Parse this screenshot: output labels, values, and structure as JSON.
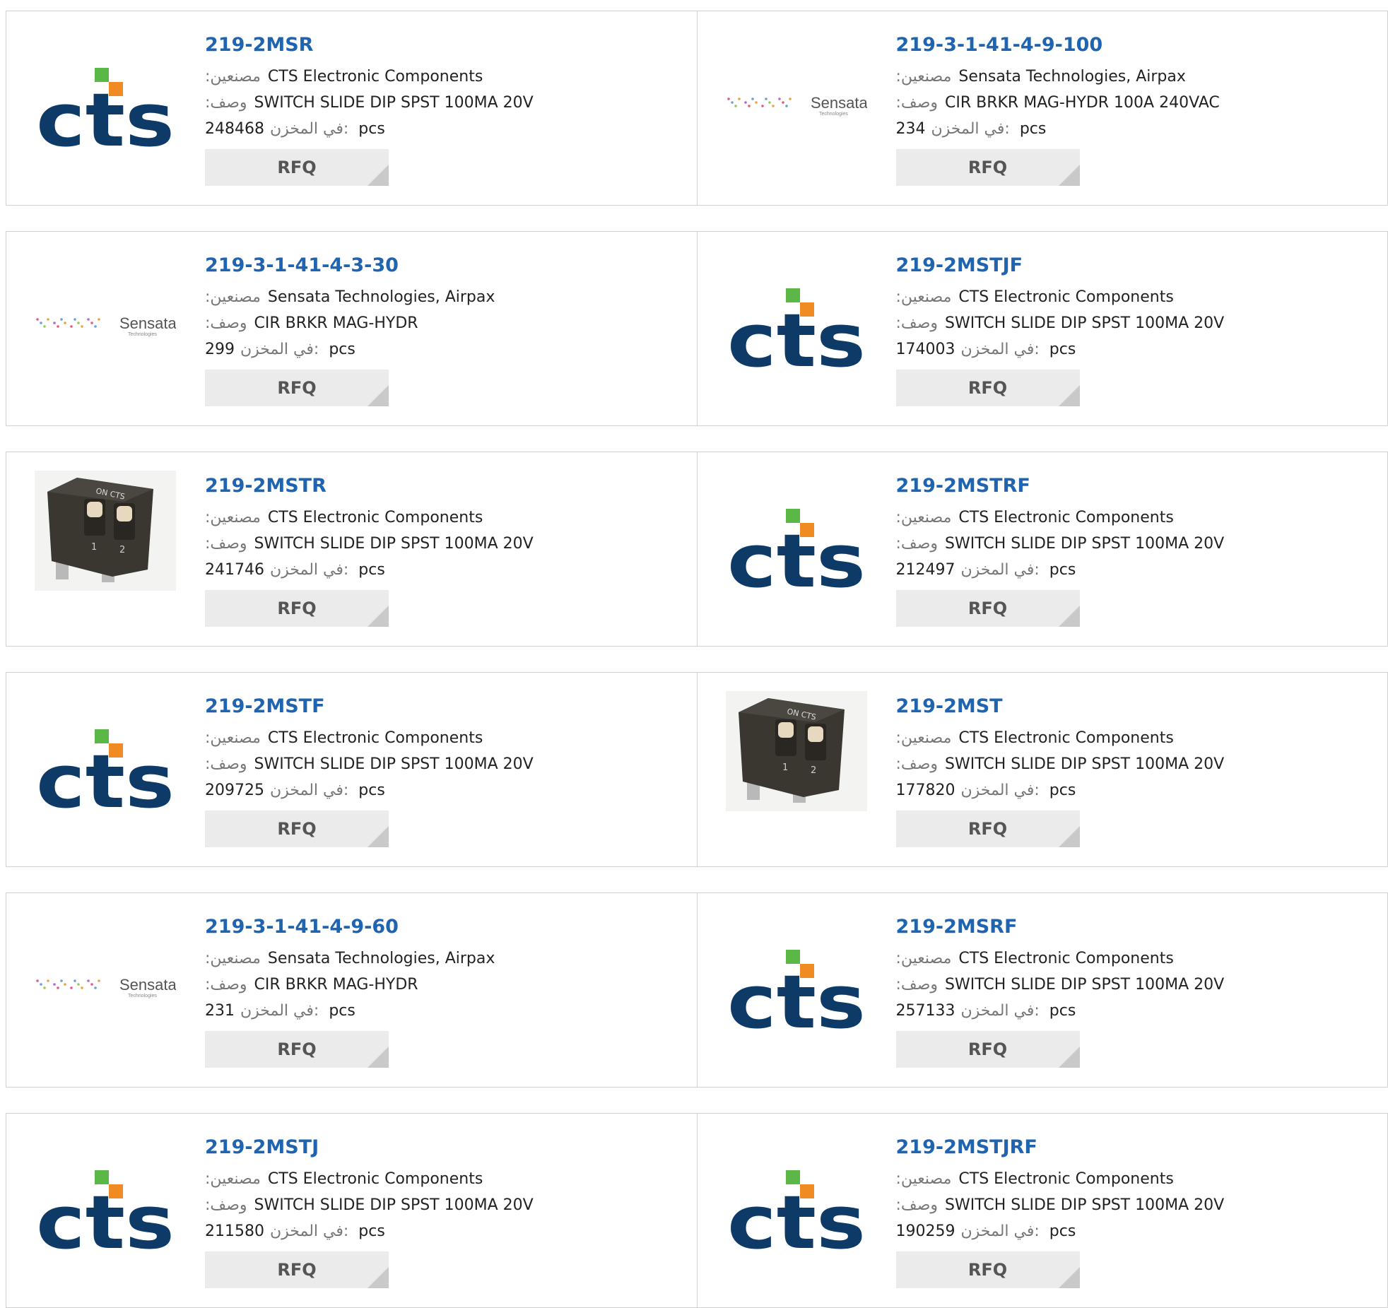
{
  "labels": {
    "manufacturer": ":مصنعين",
    "description": ":وصف",
    "stock": "في المخزن:",
    "unit": "pcs",
    "rfq": "RFQ"
  },
  "products": [
    {
      "part": "219-2MSR",
      "manufacturer": "CTS Electronic Components",
      "description": "SWITCH SLIDE DIP SPST 100MA 20V",
      "stock": "248468",
      "logo": "cts-logo"
    },
    {
      "part": "219-3-1-41-4-9-100",
      "manufacturer": "Sensata Technologies, Airpax",
      "description": "CIR BRKR MAG-HYDR 100A 240VAC",
      "stock": "234",
      "logo": "sensata-logo"
    },
    {
      "part": "219-3-1-41-4-3-30",
      "manufacturer": "Sensata Technologies, Airpax",
      "description": "CIR BRKR MAG-HYDR",
      "stock": "299",
      "logo": "sensata-logo"
    },
    {
      "part": "219-2MSTJF",
      "manufacturer": "CTS Electronic Components",
      "description": "SWITCH SLIDE DIP SPST 100MA 20V",
      "stock": "174003",
      "logo": "cts-logo"
    },
    {
      "part": "219-2MSTR",
      "manufacturer": "CTS Electronic Components",
      "description": "SWITCH SLIDE DIP SPST 100MA 20V",
      "stock": "241746",
      "logo": "dip-switch-photo"
    },
    {
      "part": "219-2MSTRF",
      "manufacturer": "CTS Electronic Components",
      "description": "SWITCH SLIDE DIP SPST 100MA 20V",
      "stock": "212497",
      "logo": "cts-logo"
    },
    {
      "part": "219-2MSTF",
      "manufacturer": "CTS Electronic Components",
      "description": "SWITCH SLIDE DIP SPST 100MA 20V",
      "stock": "209725",
      "logo": "cts-logo"
    },
    {
      "part": "219-2MST",
      "manufacturer": "CTS Electronic Components",
      "description": "SWITCH SLIDE DIP SPST 100MA 20V",
      "stock": "177820",
      "logo": "dip-switch-photo"
    },
    {
      "part": "219-3-1-41-4-9-60",
      "manufacturer": "Sensata Technologies, Airpax",
      "description": "CIR BRKR MAG-HYDR",
      "stock": "231",
      "logo": "sensata-logo"
    },
    {
      "part": "219-2MSRF",
      "manufacturer": "CTS Electronic Components",
      "description": "SWITCH SLIDE DIP SPST 100MA 20V",
      "stock": "257133",
      "logo": "cts-logo"
    },
    {
      "part": "219-2MSTJ",
      "manufacturer": "CTS Electronic Components",
      "description": "SWITCH SLIDE DIP SPST 100MA 20V",
      "stock": "211580",
      "logo": "cts-logo"
    },
    {
      "part": "219-2MSTJRF",
      "manufacturer": "CTS Electronic Components",
      "description": "SWITCH SLIDE DIP SPST 100MA 20V",
      "stock": "190259",
      "logo": "cts-logo"
    }
  ],
  "logo_text": {
    "cts": "cts",
    "sensata": "Sensata",
    "sensata_sub": "Technologies",
    "dip_on": "ON CTS",
    "dip_1": "1",
    "dip_2": "2"
  },
  "colors": {
    "link": "#1f64b0",
    "cts_navy": "#0e3a68",
    "cts_green": "#5cb846",
    "cts_orange": "#f08a22"
  }
}
